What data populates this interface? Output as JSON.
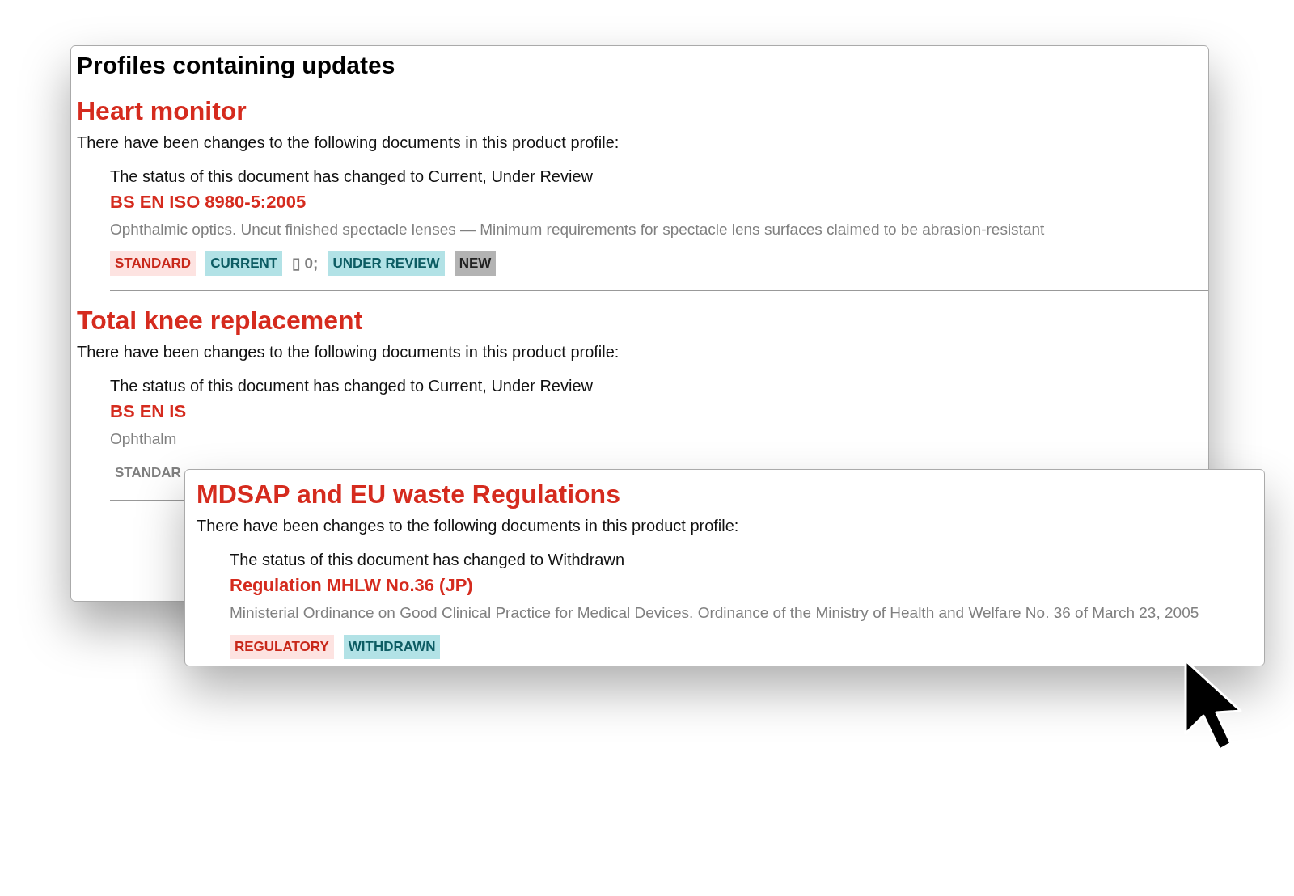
{
  "heading": "Profiles containing updates",
  "profiles": [
    {
      "name": "Heart monitor",
      "intro": "There have been changes to the following documents in this product profile:",
      "documents": [
        {
          "status_note": "The status of this document has changed to Current, Under Review",
          "code": "BS EN ISO 8980-5:2005",
          "description": "Ophthalmic optics. Uncut finished spectacle lenses — Minimum requirements for spectacle lens surfaces claimed to be abrasion-resistant",
          "tags": [
            {
              "label": "STANDARD",
              "kind": "type"
            },
            {
              "label": "CURRENT",
              "kind": "status"
            },
            {
              "label": "▯ 0;",
              "kind": "text"
            },
            {
              "label": "UNDER REVIEW",
              "kind": "status"
            },
            {
              "label": "NEW",
              "kind": "new"
            }
          ]
        }
      ]
    },
    {
      "name": "Total knee replacement",
      "intro": "There have been changes to the following documents in this product profile:",
      "documents": [
        {
          "status_note": "The status of this document has changed to Current, Under Review",
          "code": "BS EN IS",
          "description": "Ophthalm",
          "tags": [
            {
              "label": "STANDAR",
              "kind": "faded"
            }
          ]
        }
      ]
    }
  ],
  "popup": {
    "name": "MDSAP and EU waste Regulations",
    "intro": "There have been changes to the following documents in this product profile:",
    "documents": [
      {
        "status_note": "The status of this document has changed to Withdrawn",
        "code": "Regulation MHLW No.36 (JP)",
        "description": "Ministerial Ordinance on Good Clinical Practice for Medical Devices. Ordinance of the Ministry of Health and Welfare No. 36 of March 23, 2005",
        "tags": [
          {
            "label": "REGULATORY",
            "kind": "type"
          },
          {
            "label": "WITHDRAWN",
            "kind": "status"
          }
        ]
      }
    ]
  }
}
